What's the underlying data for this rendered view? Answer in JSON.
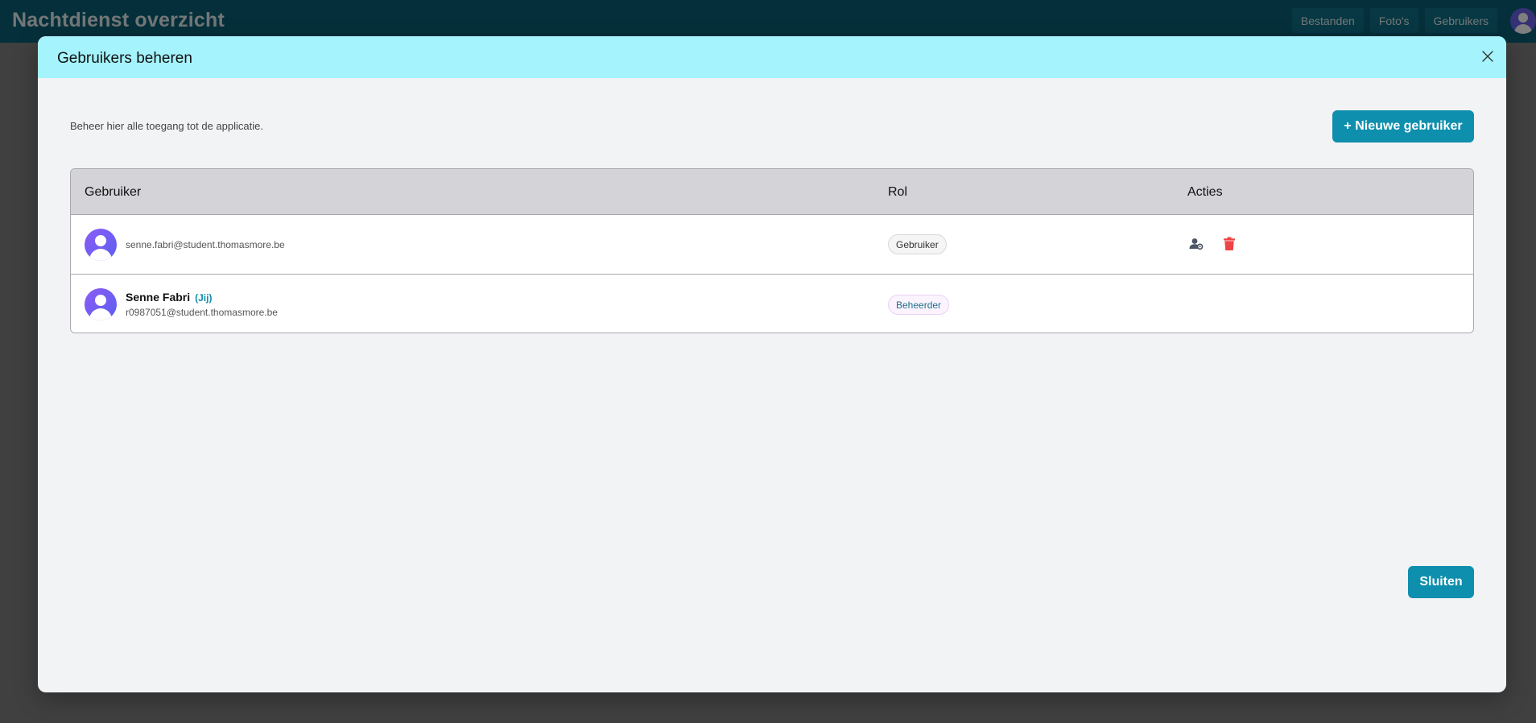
{
  "app": {
    "title": "Nachtdienst overzicht",
    "nav": [
      "Bestanden",
      "Foto's",
      "Gebruikers"
    ]
  },
  "modal": {
    "title": "Gebruikers beheren",
    "intro": "Beheer hier alle toegang tot de applicatie.",
    "new_user_label": "+ Nieuwe gebruiker",
    "close_label": "Sluiten",
    "table": {
      "headers": {
        "user": "Gebruiker",
        "role": "Rol",
        "actions": "Acties"
      },
      "rows": [
        {
          "name": "",
          "email": "senne.fabri@student.thomasmore.be",
          "role": "Gebruiker",
          "you": ""
        },
        {
          "name": "Senne Fabri",
          "email": "r0987051@student.thomasmore.be",
          "role": "Beheerder",
          "you": "(Jij)"
        }
      ]
    }
  },
  "colors": {
    "header_accent": "#a5f3fc",
    "primary_button": "#0e8fad",
    "delete_icon": "#ef4444",
    "avatar": "#7c5cf0"
  },
  "icons": {
    "close": "close-icon",
    "change_role": "user-cog-icon",
    "delete": "trash-icon",
    "avatar": "user-avatar-icon"
  }
}
